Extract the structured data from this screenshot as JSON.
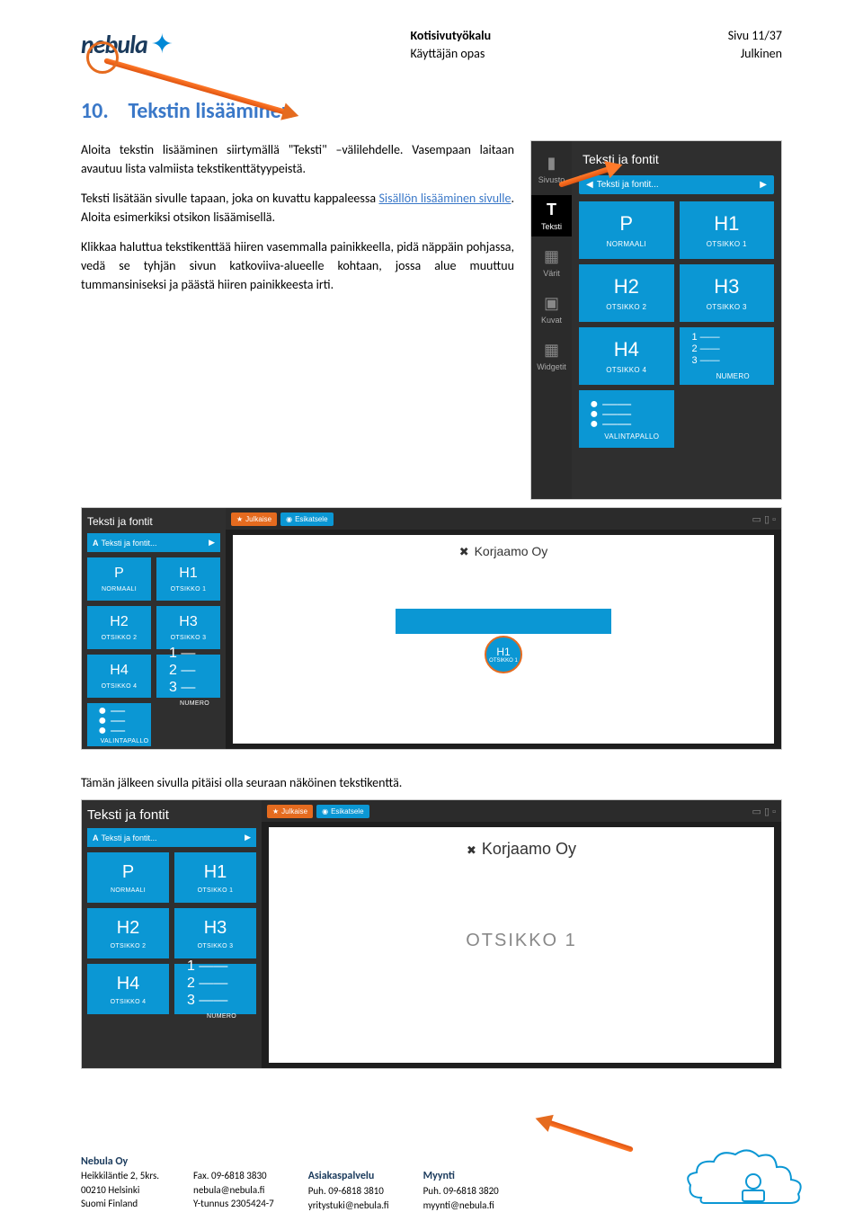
{
  "header": {
    "brand": "nebula",
    "doc_title": "Kotisivutyökalu",
    "doc_sub": "Käyttäjän opas",
    "page_no": "Sivu 11/37",
    "visibility": "Julkinen"
  },
  "section": {
    "number": "10.",
    "title": "Tekstin lisääminen",
    "p1": "Aloita tekstin lisääminen siirtymällä \"Teksti\" –välilehdelle. Vasempaan laitaan avautuu lista valmiista tekstikenttätyypeistä.",
    "p2a": "Teksti lisätään sivulle tapaan, joka on kuvattu kappaleessa ",
    "p2link": "Sisällön lisääminen sivulle",
    "p2b": ". Aloita esimerkiksi otsikon lisäämisellä.",
    "p3": "Klikkaa haluttua tekstikenttää hiiren vasemmalla painikkeella, pidä näppäin pohjassa, vedä se tyhjän sivun katkoviiva-alueelle kohtaan, jossa alue muuttuu tummansiniseksi ja päästä hiiren painikkeesta irti.",
    "after": "Tämän jälkeen sivulla pitäisi olla seuraan näköinen tekstikenttä."
  },
  "ui": {
    "panel_title": "Teksti ja fontit",
    "bread": "Teksti ja fontit...",
    "rail": {
      "sivusto": "Sivusto",
      "teksti": "Teksti",
      "varit": "Värit",
      "kuvat": "Kuvat",
      "widgetit": "Widgetit"
    },
    "tiles": {
      "p": "P",
      "p_cap": "NORMAALI",
      "h1": "H1",
      "h1_cap": "OTSIKKO 1",
      "h2": "H2",
      "h2_cap": "OTSIKKO 2",
      "h3": "H3",
      "h3_cap": "OTSIKKO 3",
      "h4": "H4",
      "h4_cap": "OTSIKKO 4",
      "num_cap": "NUMERO",
      "val_cap": "VALINTAPALLO"
    },
    "topbar": {
      "julkaise": "Julkaise",
      "esikatsele": "Esikatsele"
    },
    "company": "Korjaamo Oy",
    "dropped_text": "OTSIKKO 1"
  },
  "footer": {
    "company": "Nebula Oy",
    "c1": {
      "l1": "Heikkiläntie 2, 5krs.",
      "l2": "00210 Helsinki",
      "l3": "Suomi Finland"
    },
    "c2": {
      "l1": "Fax. 09-6818 3830",
      "l2": "nebula@nebula.fi",
      "l3": "Y-tunnus 2305424-7"
    },
    "c3": {
      "h": "Asiakaspalvelu",
      "l1": "Puh. 09-6818 3810",
      "l2": "yritystuki@nebula.fi"
    },
    "c4": {
      "h": "Myynti",
      "l1": "Puh. 09-6818 3820",
      "l2": "myynti@nebula.fi"
    }
  }
}
